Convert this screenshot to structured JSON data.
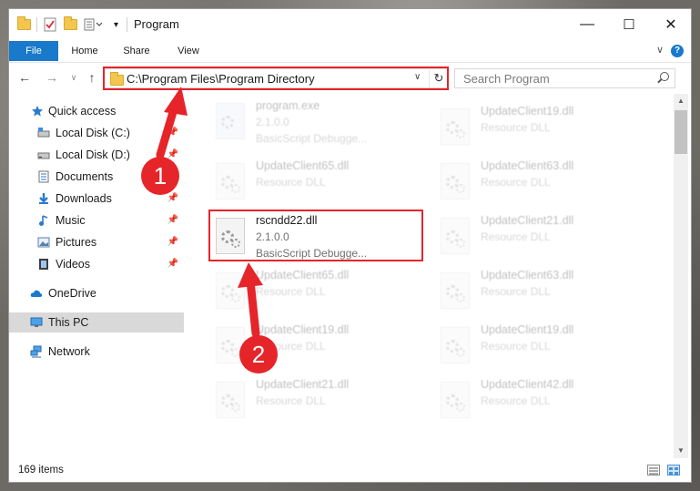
{
  "window": {
    "title": "Program",
    "minimize": "—",
    "maximize": "☐",
    "close": "✕"
  },
  "ribbon": {
    "file": "File",
    "home": "Home",
    "share": "Share",
    "view": "View",
    "collapse": "∨",
    "help": "?"
  },
  "nav": {
    "back": "←",
    "forward": "→",
    "recent": "∨",
    "up": "↑",
    "address": "C:\\Program Files\\Program Directory",
    "dropdown": "∨",
    "refresh": "↻",
    "search_placeholder": "Search Program"
  },
  "sidebar": {
    "items": [
      {
        "label": "Quick access"
      },
      {
        "label": "Local Disk (C:)"
      },
      {
        "label": "Local Disk (D:)"
      },
      {
        "label": "Documents"
      },
      {
        "label": "Downloads"
      },
      {
        "label": "Music"
      },
      {
        "label": "Pictures"
      },
      {
        "label": "Videos"
      },
      {
        "label": "OneDrive"
      },
      {
        "label": "This PC"
      },
      {
        "label": "Network"
      }
    ]
  },
  "files": [
    {
      "name": "program.exe",
      "version": "2.1.0.0",
      "desc": "BasicScript Debugge..."
    },
    {
      "name": "UpdateClient19.dll",
      "version": "Resource DLL",
      "desc": ""
    },
    {
      "name": "UpdateClient65.dll",
      "version": "Resource DLL",
      "desc": ""
    },
    {
      "name": "UpdateClient63.dll",
      "version": "Resource DLL",
      "desc": ""
    },
    {
      "name": "rscndd22.dll",
      "version": "2.1.0.0",
      "desc": "BasicScript Debugge..."
    },
    {
      "name": "UpdateClient21.dll",
      "version": "Resource DLL",
      "desc": ""
    },
    {
      "name": "UpdateClient65.dll",
      "version": "Resource DLL",
      "desc": ""
    },
    {
      "name": "UpdateClient63.dll",
      "version": "Resource DLL",
      "desc": ""
    },
    {
      "name": "UpdateClient19.dll",
      "version": "Resource DLL",
      "desc": ""
    },
    {
      "name": "UpdateClient19.dll",
      "version": "Resource DLL",
      "desc": ""
    },
    {
      "name": "UpdateClient21.dll",
      "version": "Resource DLL",
      "desc": ""
    },
    {
      "name": "UpdateClient42.dll",
      "version": "Resource DLL",
      "desc": ""
    }
  ],
  "status": {
    "count": "169 items"
  },
  "annotations": {
    "step1": "1",
    "step2": "2"
  },
  "colors": {
    "accent": "#1979ca",
    "highlight": "#e5252a",
    "folder": "#f3c64f"
  }
}
